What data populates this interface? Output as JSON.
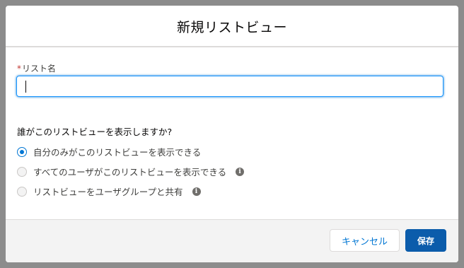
{
  "modal": {
    "title": "新規リストビュー"
  },
  "form": {
    "name_label": "リスト名",
    "name_required_marker": "*",
    "name_value": "",
    "visibility_question": "誰がこのリストビューを表示しますか?",
    "options": [
      {
        "label": "自分のみがこのリストビューを表示できる",
        "checked": true,
        "info": false
      },
      {
        "label": "すべてのユーザがこのリストビューを表示できる",
        "checked": false,
        "info": true
      },
      {
        "label": "リストビューをユーザグループと共有",
        "checked": false,
        "info": true
      }
    ]
  },
  "footer": {
    "cancel_label": "キャンセル",
    "save_label": "保存"
  },
  "colors": {
    "brand": "#0176d3",
    "save_button": "#0b5cab",
    "required": "#c23934"
  },
  "icons": {
    "info": "info-icon"
  }
}
